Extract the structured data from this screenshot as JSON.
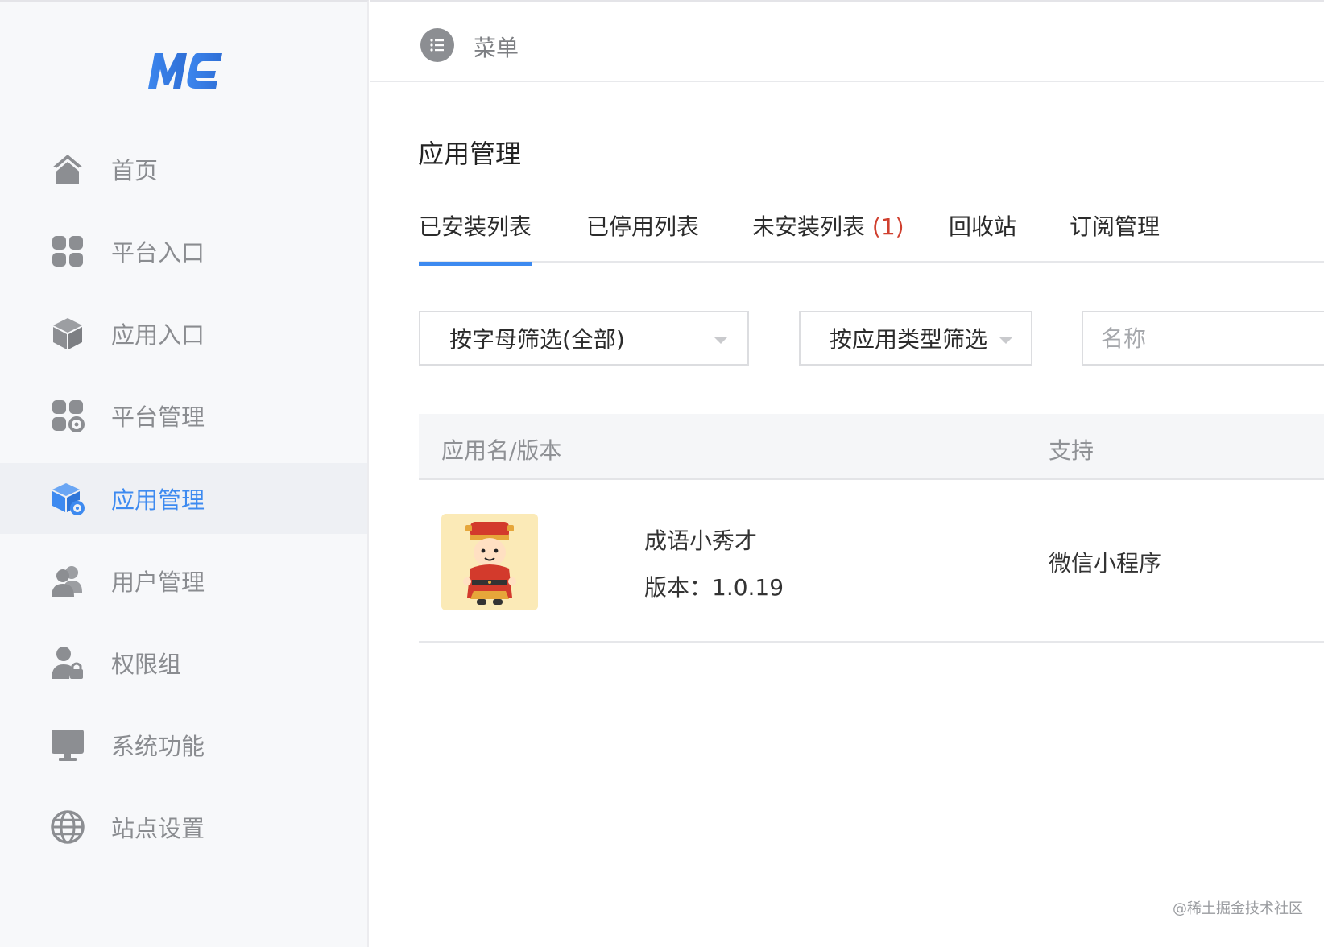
{
  "sidebar": {
    "logo_text": "ME",
    "items": [
      {
        "label": "首页",
        "icon": "home-icon"
      },
      {
        "label": "平台入口",
        "icon": "grid-icon"
      },
      {
        "label": "应用入口",
        "icon": "cube-icon"
      },
      {
        "label": "平台管理",
        "icon": "grid-gear-icon"
      },
      {
        "label": "应用管理",
        "icon": "cube-gear-icon",
        "active": true
      },
      {
        "label": "用户管理",
        "icon": "users-icon"
      },
      {
        "label": "权限组",
        "icon": "user-lock-icon"
      },
      {
        "label": "系统功能",
        "icon": "monitor-icon"
      },
      {
        "label": "站点设置",
        "icon": "globe-icon"
      }
    ]
  },
  "topbar": {
    "menu_label": "菜单",
    "menu_icon": "list-icon"
  },
  "page": {
    "title": "应用管理"
  },
  "tabs": [
    {
      "label": "已安装列表",
      "active": true
    },
    {
      "label": "已停用列表"
    },
    {
      "label": "未安装列表",
      "count": "(1)"
    },
    {
      "label": "回收站"
    },
    {
      "label": "订阅管理"
    }
  ],
  "filters": {
    "letter": "按字母筛选(全部)",
    "type": "按应用类型筛选",
    "name_placeholder": "名称"
  },
  "table": {
    "headers": {
      "name": "应用名/版本",
      "support": "支持"
    },
    "rows": [
      {
        "name": "成语小秀才",
        "version": "版本：1.0.19",
        "support": "微信小程序",
        "thumb": "cartoon-scholar-avatar"
      }
    ]
  },
  "watermark": "@稀土掘金技术社区",
  "colors": {
    "accent": "#3d8af0",
    "count_red": "#d0402f",
    "sidebar_bg": "#f7f8fa"
  }
}
